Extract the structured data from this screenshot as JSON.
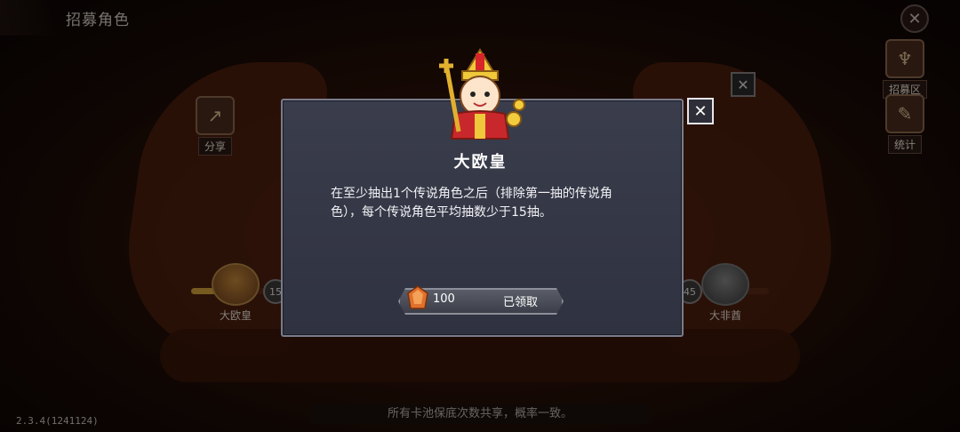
{
  "header": {
    "title": "招募角色"
  },
  "left_buttons": [
    {
      "label": "分享",
      "icon": "share-icon"
    }
  ],
  "right_buttons": [
    {
      "label": "招募区",
      "icon": "recruit-emblem-icon"
    },
    {
      "label": "统计",
      "icon": "pencil-icon"
    }
  ],
  "progress": {
    "badges": [
      "15",
      "45"
    ],
    "fill_fraction": 0.09,
    "milestones": [
      {
        "label": "大欧皇",
        "style": "gold"
      },
      {
        "label": "大非酋",
        "style": "gray"
      }
    ]
  },
  "footer": {
    "note": "所有卡池保底次数共享，概率一致。",
    "version": "2.3.4(1241124)"
  },
  "modal": {
    "title": "大欧皇",
    "description": "在至少抽出1个传说角色之后（排除第一抽的传说角色），每个传说角色平均抽数少于15抽。",
    "reward": {
      "amount": "100",
      "status": "已领取",
      "icon": "orange-gem-icon"
    },
    "close_icon": "close-icon"
  },
  "colors": {
    "modal_bg": "#343746",
    "modal_border": "#7a7c8c",
    "accent_gold": "#d9a43b",
    "gem_orange": "#e0712c"
  }
}
